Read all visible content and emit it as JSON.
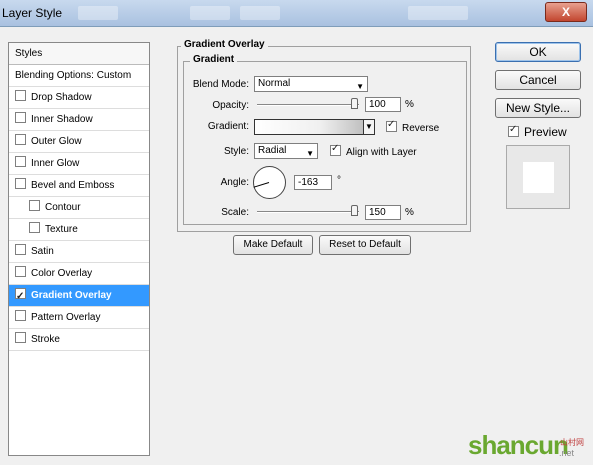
{
  "window": {
    "title": "Layer Style",
    "close_label": "X"
  },
  "styles_panel": {
    "header": "Styles",
    "items": [
      {
        "label": "Blending Options: Custom",
        "checkbox": false,
        "checked": false,
        "indent": false,
        "selected": false
      },
      {
        "label": "Drop Shadow",
        "checkbox": true,
        "checked": false,
        "indent": false,
        "selected": false
      },
      {
        "label": "Inner Shadow",
        "checkbox": true,
        "checked": false,
        "indent": false,
        "selected": false
      },
      {
        "label": "Outer Glow",
        "checkbox": true,
        "checked": false,
        "indent": false,
        "selected": false
      },
      {
        "label": "Inner Glow",
        "checkbox": true,
        "checked": false,
        "indent": false,
        "selected": false
      },
      {
        "label": "Bevel and Emboss",
        "checkbox": true,
        "checked": false,
        "indent": false,
        "selected": false
      },
      {
        "label": "Contour",
        "checkbox": true,
        "checked": false,
        "indent": true,
        "selected": false
      },
      {
        "label": "Texture",
        "checkbox": true,
        "checked": false,
        "indent": true,
        "selected": false
      },
      {
        "label": "Satin",
        "checkbox": true,
        "checked": false,
        "indent": false,
        "selected": false
      },
      {
        "label": "Color Overlay",
        "checkbox": true,
        "checked": false,
        "indent": false,
        "selected": false
      },
      {
        "label": "Gradient Overlay",
        "checkbox": true,
        "checked": true,
        "indent": false,
        "selected": true
      },
      {
        "label": "Pattern Overlay",
        "checkbox": true,
        "checked": false,
        "indent": false,
        "selected": false
      },
      {
        "label": "Stroke",
        "checkbox": true,
        "checked": false,
        "indent": false,
        "selected": false
      }
    ]
  },
  "gradient_overlay": {
    "section_title": "Gradient Overlay",
    "group_title": "Gradient",
    "blend_mode_label": "Blend Mode:",
    "blend_mode_value": "Normal",
    "opacity_label": "Opacity:",
    "opacity_value": "100",
    "opacity_unit": "%",
    "gradient_label": "Gradient:",
    "reverse_label": "Reverse",
    "reverse_checked": true,
    "style_label": "Style:",
    "style_value": "Radial",
    "align_label": "Align with Layer",
    "align_checked": true,
    "angle_label": "Angle:",
    "angle_value": "-163",
    "angle_unit": "°",
    "scale_label": "Scale:",
    "scale_value": "150",
    "scale_unit": "%",
    "make_default_label": "Make Default",
    "reset_default_label": "Reset to Default"
  },
  "actions": {
    "ok_label": "OK",
    "cancel_label": "Cancel",
    "new_style_label": "New Style...",
    "preview_label": "Preview",
    "preview_checked": true
  },
  "watermark": {
    "main": "shancun",
    "small_cn": "山村网",
    "small_en": ".net"
  },
  "colors": {
    "selection": "#3399ff",
    "title_bar": "#b5cbe6",
    "close_button": "#c2462f"
  }
}
